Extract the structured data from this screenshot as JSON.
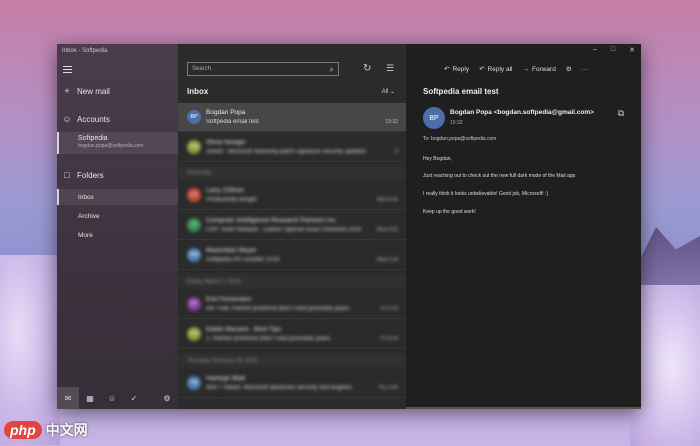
{
  "window": {
    "title": "Inbox - Softpedia"
  },
  "nav": {
    "new_mail": "New mail",
    "accounts": "Accounts",
    "account": {
      "name": "Softpedia",
      "email": "bogdan.popa@softpedia.com"
    },
    "folders": "Folders",
    "folder_items": [
      "Inbox",
      "Archive",
      "More"
    ]
  },
  "list": {
    "search_placeholder": "Search",
    "header": "Inbox",
    "filter_label": "All",
    "separators": {
      "yesterday": "Yesterday",
      "friday": "Friday, March 1, 2019",
      "thursday": "Thursday, February 28, 2019"
    },
    "messages": [
      {
        "initials": "BP",
        "color": "#4c6fa8",
        "from": "Bogdan Popa",
        "subject": "Softpedia email test",
        "time": "19:32"
      },
      {
        "initials": "DW",
        "color": "#8a9a3a",
        "from": "Olivia Newgin",
        "subject": "Shield - Microsoft Warranty patch signature security updates",
        "time": "8"
      },
      {
        "initials": "LK",
        "color": "#c64c3b",
        "from": "Larry O'Brien",
        "subject": "Productivity tonight",
        "time": "Wed 3:36"
      },
      {
        "initials": "CI",
        "color": "#3a8f55",
        "from": "Computer Intelligence Research Partners Inc",
        "subject": "CRP Team Release - Edition Special Issue Unlocked 2019",
        "time": "Wed 3:22"
      },
      {
        "initials": "MM",
        "color": "#4c7fb0",
        "from": "Maximilian Meyer",
        "subject": "Softpedia PR October 2019",
        "time": "Wed 2:18"
      },
      {
        "initials": "EF",
        "color": "#8a3fa0",
        "from": "Erik Finnemann",
        "subject": "Re: Fwd: Partner proforma Best Fixed proceeds plans",
        "time": "Fri 9:10"
      },
      {
        "initials": "EM",
        "color": "#8a9a3a",
        "from": "Edwin Macario - Best Tips",
        "subject": "1. Partner proforma Best Fixed proceeds plans",
        "time": "Fri 8:44"
      },
      {
        "initials": "HB",
        "color": "#4c7fb0",
        "from": "Harleigh Blatt",
        "subject": "MSFT Newsl. Microsoft advances security and engines",
        "time": "Thu 3:05"
      }
    ]
  },
  "reading": {
    "toolbar": {
      "reply": "Reply",
      "reply_all": "Reply all",
      "forward": "Forward"
    },
    "subject": "Softpedia email test",
    "sender_initials": "BP",
    "sender": "Bogdan Popa <bogdan.softpedia@gmail.com>",
    "time": "19:32",
    "to": "To: bogdan.popa@softpedia.com",
    "body": [
      "Hey Bogdan,",
      "Just reaching out to check out the new full dark mode of the Mail app",
      "I really think it looks unbelievable! Good job, Microsoft! :)",
      "Keep up the good work!"
    ]
  },
  "watermark": {
    "brand": "php",
    "suffix": "中文网"
  },
  "colors": {
    "accent": "#4c6fa8",
    "nav_bg": "#3f3440",
    "list_bg": "#2b2b2b",
    "read_bg": "#1f1f1f"
  }
}
